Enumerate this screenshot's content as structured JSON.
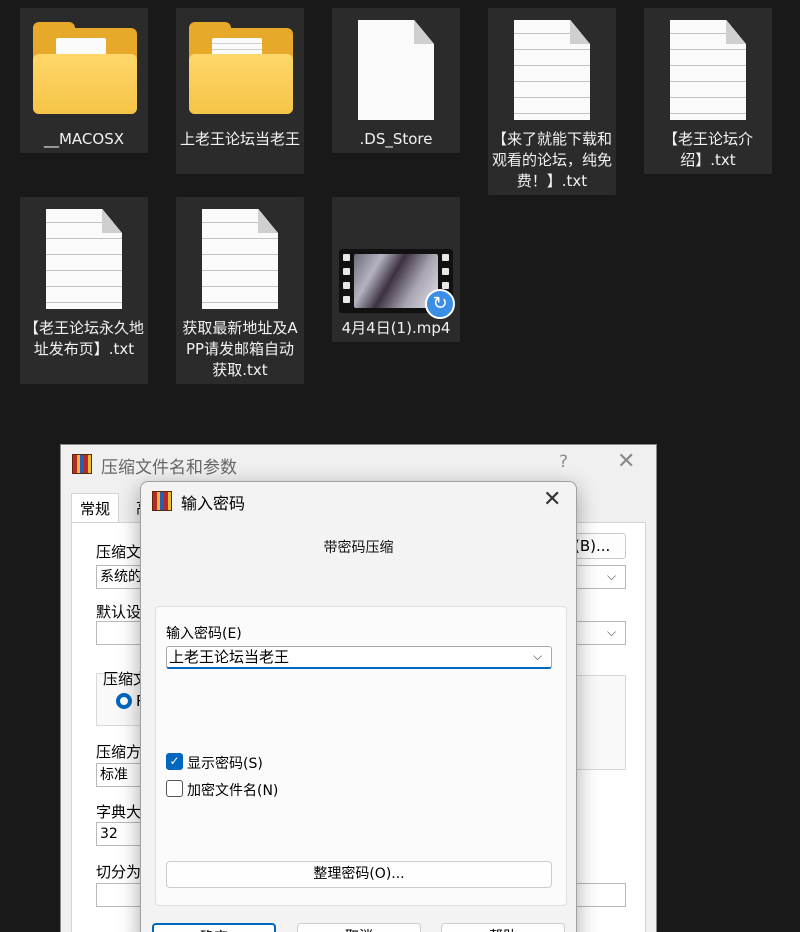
{
  "desktop": {
    "files": [
      {
        "label": "__MACOSX",
        "icon": "folder-icon"
      },
      {
        "label": "上老王论坛当老王",
        "icon": "folder-icon"
      },
      {
        "label": ".DS_Store",
        "icon": "blank-file-icon"
      },
      {
        "label": "【来了就能下载和观看的论坛，纯免费！】.txt",
        "icon": "text-file-icon"
      },
      {
        "label": "【老王论坛介绍】.txt",
        "icon": "text-file-icon"
      },
      {
        "label": "【老王论坛永久地址发布页】.txt",
        "icon": "text-file-icon"
      },
      {
        "label": "获取最新地址及APP请发邮箱自动获取.txt",
        "icon": "text-file-icon"
      },
      {
        "label": "4月4日(1).mp4",
        "icon": "video-file-icon"
      }
    ]
  },
  "archive_dialog": {
    "title": "压缩文件名和参数",
    "help": "?",
    "close": "✕",
    "tabs": [
      "常规",
      "高"
    ],
    "fields": {
      "archive_name_label": "压缩文件",
      "archive_name_value": "系统的",
      "browse_button": "(B)...",
      "default_profile_label": "默认设置",
      "default_profile_value": "",
      "format_label": "压缩文",
      "format_option": "R",
      "method_label": "压缩方式",
      "method_value": "标准",
      "dictionary_label": "字典大小",
      "dictionary_value": "32",
      "split_label": "切分为分",
      "split_value": ""
    }
  },
  "password_dialog": {
    "title": "输入密码",
    "close": "✕",
    "subtitle": "带密码压缩",
    "password_label": "输入密码(E)",
    "password_value": "上老王论坛当老王",
    "show_password": {
      "label": "显示密码(S)",
      "checked": true
    },
    "encrypt_filenames": {
      "label": "加密文件名(N)",
      "checked": false
    },
    "organize_button": "整理密码(O)...",
    "buttons": [
      "确定",
      "取消",
      "帮助"
    ]
  },
  "colors": {
    "accent": "#0067c0",
    "folder": "#f6c447",
    "desktop": "#191919",
    "tile": "#2b2b2b"
  }
}
